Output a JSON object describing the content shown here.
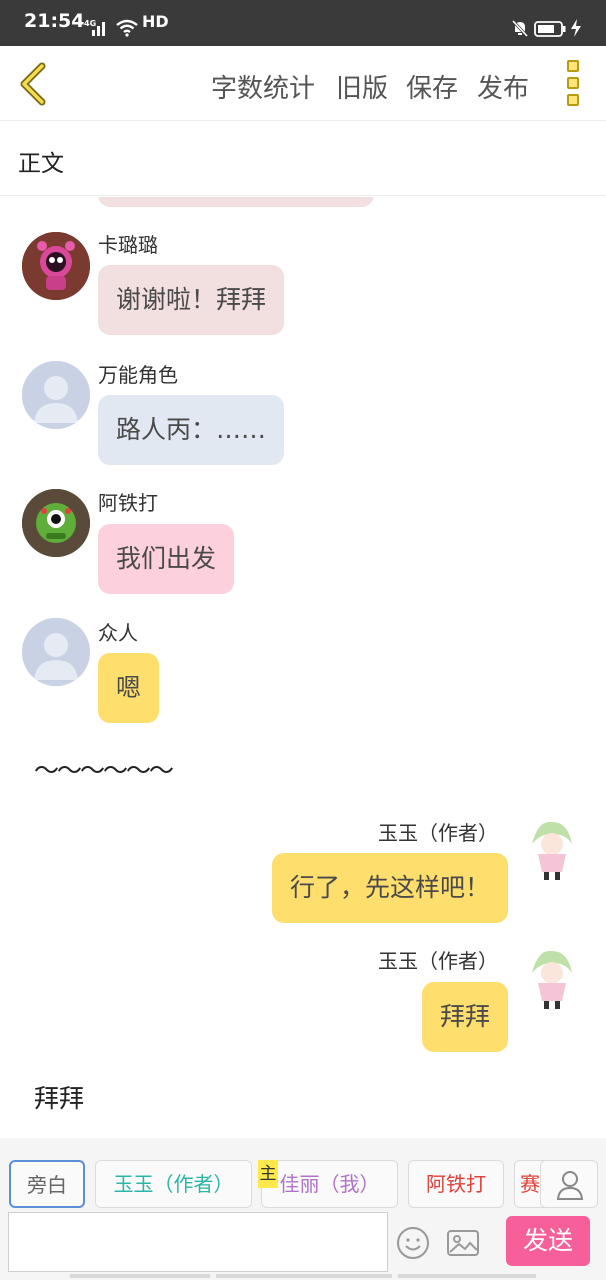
{
  "status_bar": {
    "time": "21:54",
    "network": "4G",
    "quality": "HD"
  },
  "header": {
    "back_icon": "chevron-left-icon",
    "actions": [
      "字数统计",
      "旧版",
      "保存",
      "发布"
    ],
    "more_icon": "vertical-dots-icon",
    "accent": "#b99a13"
  },
  "section": {
    "label": "正文"
  },
  "messages": [
    {
      "name": "卡璐璐",
      "text": "谢谢啦！拜拜",
      "bubble_color": "#f2dfe0"
    },
    {
      "name": "万能角色",
      "text": "路人丙：……",
      "bubble_color": "#e2e8f1"
    },
    {
      "name": "阿铁打",
      "text": "我们出发",
      "bubble_color": "#fdd0dd"
    },
    {
      "name": "众人",
      "text": "嗯",
      "bubble_color": "#fede6d"
    }
  ],
  "narration_1": "〜〜〜〜〜〜",
  "author_messages": [
    {
      "name": "玉玉（作者）",
      "text": "行了，先这样吧！",
      "bubble_color": "#fede6d"
    },
    {
      "name": "玉玉（作者）",
      "text": "拜拜",
      "bubble_color": "#fede6d"
    }
  ],
  "narration_2": "拜拜",
  "character_chips": [
    {
      "label": "旁白",
      "color": "#666666"
    },
    {
      "label": "玉玉（作者）",
      "color": "#2bb5a8"
    },
    {
      "label": "佳丽（我）",
      "color": "#b073c9"
    },
    {
      "label": "阿铁打",
      "color": "#e0403a"
    },
    {
      "label": "赛",
      "color": "#e0403a"
    }
  ],
  "main_tag": "主",
  "input": {
    "placeholder": ""
  },
  "send_label": "发送",
  "icons": [
    "emoji-icon",
    "image-icon",
    "person-icon"
  ]
}
